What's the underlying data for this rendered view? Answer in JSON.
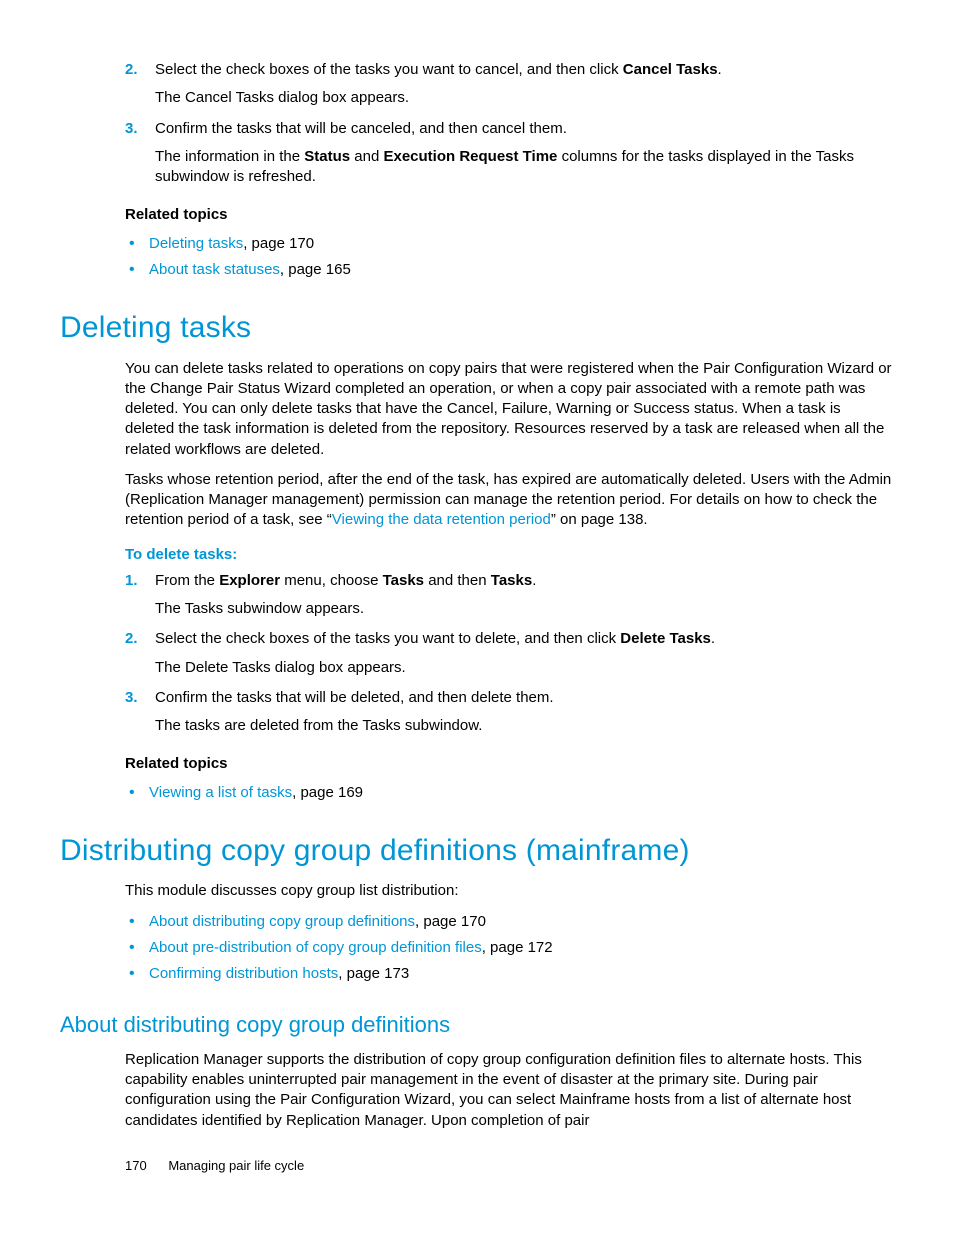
{
  "top": {
    "step2a": "Select the check boxes of the tasks you want to cancel, and then click ",
    "step2b": "Cancel Tasks",
    "step2c": ".",
    "step2_sub": "The Cancel Tasks dialog box appears.",
    "step3": "Confirm the tasks that will be canceled, and then cancel them.",
    "step3_sub_a": "The information in the ",
    "step3_sub_b": "Status",
    "step3_sub_c": " and ",
    "step3_sub_d": "Execution Request Time",
    "step3_sub_e": " columns for the tasks displayed in the Tasks subwindow is refreshed."
  },
  "related1": {
    "heading": "Related topics",
    "item1_link": "Deleting tasks",
    "item1_tail": ", page 170",
    "item2_link": "About task statuses",
    "item2_tail": ", page 165"
  },
  "deleting": {
    "heading": "Deleting tasks",
    "p1": "You can delete tasks related to operations on copy pairs that were registered when the Pair Configuration Wizard or the Change Pair Status Wizard completed an operation, or when a copy pair associated with a remote path was deleted. You can only delete tasks that have the Cancel, Failure, Warning or Success status. When a task is deleted the task information is deleted from the repository. Resources reserved by a task are released when all the related workflows are deleted.",
    "p2a": "Tasks whose retention period, after the end of the task, has expired are automatically deleted. Users with the Admin (Replication Manager management) permission can manage the retention period. For details on how to check the retention period of a task, see “",
    "p2_link": "Viewing the data retention period",
    "p2b": "” on page 138.",
    "proc_label": "To delete tasks:",
    "s1a": "From the ",
    "s1b": "Explorer",
    "s1c": " menu, choose ",
    "s1d": "Tasks",
    "s1e": " and then ",
    "s1f": "Tasks",
    "s1g": ".",
    "s1_sub": "The Tasks subwindow appears.",
    "s2a": "Select the check boxes of the tasks you want to delete, and then click ",
    "s2b": "Delete Tasks",
    "s2c": ".",
    "s2_sub": "The Delete Tasks dialog box appears.",
    "s3": "Confirm the tasks that will be deleted, and then delete them.",
    "s3_sub": "The tasks are deleted from the Tasks subwindow."
  },
  "related2": {
    "heading": "Related topics",
    "item1_link": "Viewing a list of tasks",
    "item1_tail": ", page 169"
  },
  "dist": {
    "heading": "Distributing copy group definitions (mainframe)",
    "intro": "This module discusses copy group list distribution:",
    "b1_link": "About distributing copy group definitions",
    "b1_tail": ", page 170",
    "b2_link": "About pre-distribution of copy group definition files",
    "b2_tail": ", page 172",
    "b3_link": "Confirming distribution hosts",
    "b3_tail": ", page 173",
    "sub_heading": "About distributing copy group definitions",
    "sub_p": "Replication Manager supports the distribution of copy group configuration definition files to alternate hosts. This capability enables uninterrupted pair management in the event of disaster at the primary site. During pair configuration using the Pair Configuration Wizard, you can select Mainframe hosts from a list of alternate host candidates identified by Replication Manager. Upon completion of pair"
  },
  "footer": {
    "page": "170",
    "title": "Managing pair life cycle"
  }
}
